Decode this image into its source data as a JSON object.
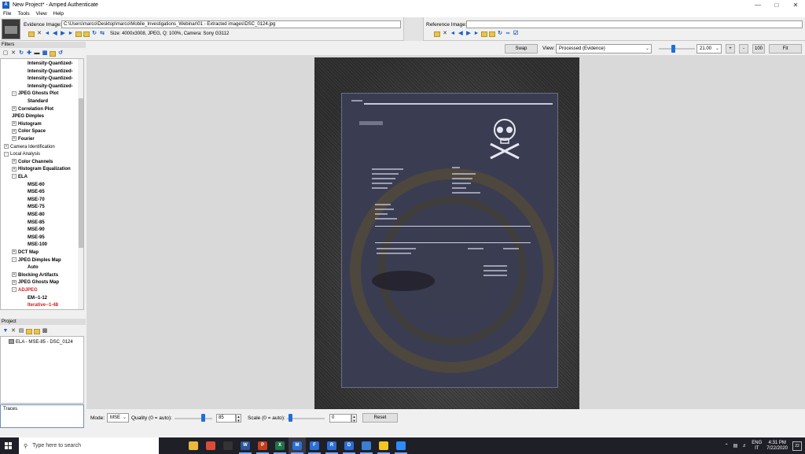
{
  "window": {
    "title": "New Project* - Amped Authenticate",
    "app_icon": "amped-logo-icon",
    "controls": [
      "minimize",
      "maximize",
      "close"
    ]
  },
  "menu": [
    "File",
    "Tools",
    "View",
    "Help"
  ],
  "evidence": {
    "label": "Evidence Image:",
    "path": "C:\\Users\\marco\\Desktop\\marco\\Mobile_Investigations_Webinar\\01 - Extracted images\\DSC_0124.jpg",
    "info": "Size: 4000x3008, JPEG, Q: 100%, Camera: Sony G3112"
  },
  "reference": {
    "label": "Reference Image:",
    "path": ""
  },
  "filters": {
    "header": "Filters",
    "tree": [
      {
        "label": "Intensity-Quantized-",
        "indent": 3,
        "style": "bold"
      },
      {
        "label": "Intensity-Quantized-",
        "indent": 3,
        "style": "bold"
      },
      {
        "label": "Intensity-Quantized-",
        "indent": 3,
        "style": "bold"
      },
      {
        "label": "Intensity-Quantized-",
        "indent": 3,
        "style": "bold"
      },
      {
        "label": "JPEG Ghosts Plot",
        "indent": 2,
        "style": "bold",
        "exp": "-"
      },
      {
        "label": "Standard",
        "indent": 3,
        "style": "bold"
      },
      {
        "label": "Correlation Plot",
        "indent": 2,
        "style": "bold",
        "exp": "+"
      },
      {
        "label": "JPEG Dimples",
        "indent": 2,
        "style": "bold"
      },
      {
        "label": "Histogram",
        "indent": 2,
        "style": "bold",
        "exp": "+"
      },
      {
        "label": "Color Space",
        "indent": 2,
        "style": "bold",
        "exp": "+"
      },
      {
        "label": "Fourier",
        "indent": 2,
        "style": "bold",
        "exp": "+"
      },
      {
        "label": "Camera Identification",
        "indent": 1,
        "style": "normal",
        "exp": "+"
      },
      {
        "label": "Local Analysis",
        "indent": 1,
        "style": "normal",
        "exp": "-"
      },
      {
        "label": "Color Channels",
        "indent": 2,
        "style": "bold",
        "exp": "+"
      },
      {
        "label": "Histogram Equalization",
        "indent": 2,
        "style": "bold",
        "exp": "+"
      },
      {
        "label": "ELA",
        "indent": 2,
        "style": "bold",
        "exp": "-"
      },
      {
        "label": "MSE-60",
        "indent": 3,
        "style": "bold"
      },
      {
        "label": "MSE-65",
        "indent": 3,
        "style": "bold"
      },
      {
        "label": "MSE-70",
        "indent": 3,
        "style": "bold"
      },
      {
        "label": "MSE-75",
        "indent": 3,
        "style": "bold"
      },
      {
        "label": "MSE-80",
        "indent": 3,
        "style": "bold"
      },
      {
        "label": "MSE-85",
        "indent": 3,
        "style": "bold"
      },
      {
        "label": "MSE-90",
        "indent": 3,
        "style": "bold"
      },
      {
        "label": "MSE-95",
        "indent": 3,
        "style": "bold"
      },
      {
        "label": "MSE-100",
        "indent": 3,
        "style": "bold"
      },
      {
        "label": "DCT Map",
        "indent": 2,
        "style": "bold",
        "exp": "+"
      },
      {
        "label": "JPEG Dimples Map",
        "indent": 2,
        "style": "bold",
        "exp": "-"
      },
      {
        "label": "Auto",
        "indent": 3,
        "style": "bold"
      },
      {
        "label": "Blocking Artifacts",
        "indent": 2,
        "style": "bold",
        "exp": "+"
      },
      {
        "label": "JPEG Ghosts Map",
        "indent": 2,
        "style": "bold",
        "exp": "+"
      },
      {
        "label": "ADJPEG",
        "indent": 2,
        "style": "red",
        "exp": "-"
      },
      {
        "label": "EM--1-12",
        "indent": 3,
        "style": "bold"
      },
      {
        "label": "Iterative--1-48",
        "indent": 3,
        "style": "red"
      }
    ]
  },
  "project": {
    "header": "Project",
    "items": [
      "ELA - MSE-85 - DSC_0124"
    ],
    "traces_label": "Traces"
  },
  "viewer": {
    "swap_label": "Swap",
    "view_label": "View:",
    "view_value": "Processed (Evidence)",
    "zoom_value": "21.00",
    "plus_label": "+",
    "minus_label": "-",
    "hundred_label": "100",
    "fit_label": "Fit"
  },
  "controls": {
    "mode_label": "Mode:",
    "mode_value": "MSE",
    "quality_label": "Quality (0 = auto):",
    "quality_value": "85",
    "scale_label": "Scale (0 = auto):",
    "scale_value": "0",
    "reset_label": "Reset"
  },
  "taskbar": {
    "search_placeholder": "Type here to search",
    "lang_top": "ENG",
    "lang_bottom": "IT",
    "time": "4:31 PM",
    "date": "7/22/2020",
    "notif_count": "22",
    "apps": [
      {
        "name": "file-explorer-icon",
        "glyph": "",
        "color": "#e8b93a"
      },
      {
        "name": "chrome-icon",
        "glyph": "",
        "color": "#d94c3a"
      },
      {
        "name": "terminal-icon",
        "glyph": "",
        "color": "#333"
      },
      {
        "name": "word-icon",
        "glyph": "W",
        "color": "#2b579a"
      },
      {
        "name": "powerpoint-icon",
        "glyph": "P",
        "color": "#c43e1c"
      },
      {
        "name": "excel-icon",
        "glyph": "X",
        "color": "#217346"
      },
      {
        "name": "amped-authenticate-icon",
        "glyph": "M",
        "color": "#2b6fd6"
      },
      {
        "name": "amped-five-icon",
        "glyph": "F",
        "color": "#2b6fd6"
      },
      {
        "name": "amped-replay-icon",
        "glyph": "R",
        "color": "#2b6fd6"
      },
      {
        "name": "amped-dvrconv-icon",
        "glyph": "D",
        "color": "#2b6fd6"
      },
      {
        "name": "remote-desktop-icon",
        "glyph": "",
        "color": "#3b7fd0"
      },
      {
        "name": "sticky-notes-icon",
        "glyph": "",
        "color": "#f3c623"
      },
      {
        "name": "zoom-icon",
        "glyph": "",
        "color": "#2d8cff"
      }
    ]
  }
}
